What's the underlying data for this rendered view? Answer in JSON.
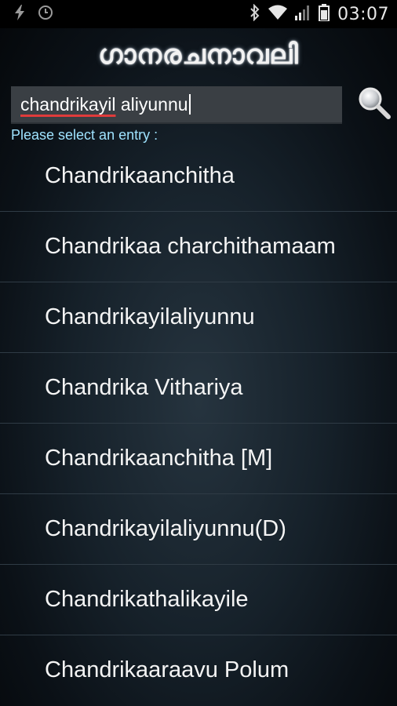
{
  "status_bar": {
    "left_icons": [
      "charging-icon",
      "clock-alarm-icon"
    ],
    "right_icons": [
      "bluetooth-icon",
      "wifi-icon",
      "signal-icon",
      "battery-icon"
    ],
    "time": "03:07"
  },
  "app": {
    "title": "ഗാനരചനാവലി"
  },
  "search": {
    "value_underlined": "chandrikayil",
    "value_rest": " aliyunnu",
    "button_icon": "search-icon"
  },
  "prompt": "Please select an entry :",
  "entries": [
    {
      "label": "Chandrikaanchitha"
    },
    {
      "label": "Chandrikaa charchithamaam"
    },
    {
      "label": "Chandrikayilaliyunnu"
    },
    {
      "label": "Chandrika Vithariya"
    },
    {
      "label": "Chandrikaanchitha [M]"
    },
    {
      "label": "Chandrikayilaliyunnu(D)"
    },
    {
      "label": "Chandrikathalikayile"
    },
    {
      "label": "Chandrikaaraavu Polum"
    }
  ],
  "colors": {
    "prompt_text": "#9fe3ff",
    "search_bg": "#3a3f44",
    "spellcheck_underline": "#e03b3b"
  }
}
